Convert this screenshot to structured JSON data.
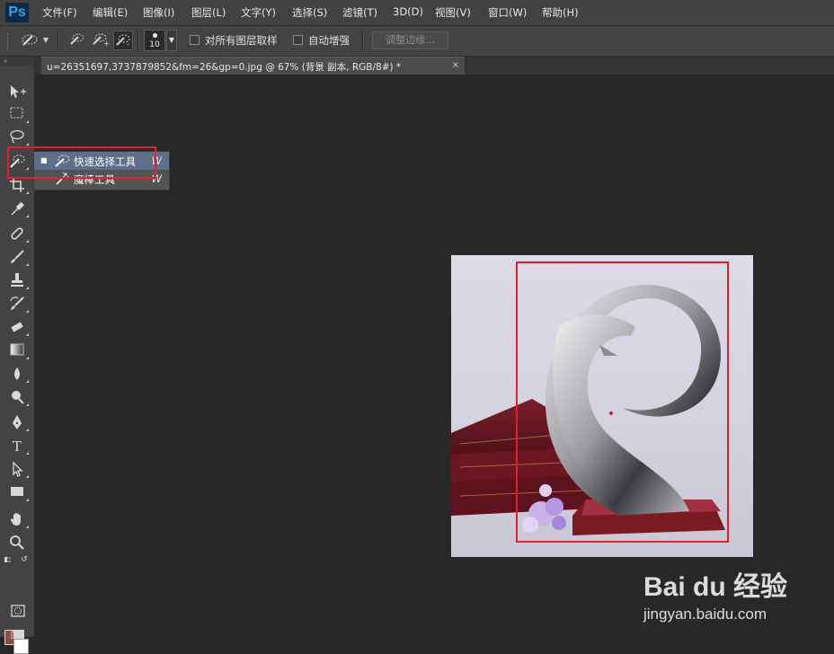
{
  "app": {
    "logo": "Ps",
    "menu": [
      "文件(F)",
      "编辑(E)",
      "图像(I)",
      "图层(L)",
      "文字(Y)",
      "选择(S)",
      "滤镜(T)",
      "3D(D)",
      "视图(V)",
      "窗口(W)",
      "帮助(H)"
    ]
  },
  "options": {
    "brush_size": "10",
    "sample_all_layers_label": "对所有图层取样",
    "auto_enhance_label": "自动增强",
    "refine_edge_label": "调整边缘..."
  },
  "document": {
    "tab_title": "u=26351697,3737879852&fm=26&gp=0.jpg @ 67% (背景 副本, RGB/8#) *",
    "close_glyph": "×"
  },
  "toolbox": {
    "header": "»",
    "foreground_color": "#8b4d3d",
    "background_color": "#ffffff"
  },
  "flyout": {
    "items": [
      {
        "label": "快速选择工具",
        "shortcut": "W",
        "selected": true,
        "icon": "quick-selection-icon"
      },
      {
        "label": "魔棒工具",
        "shortcut": "W",
        "selected": false,
        "icon": "magic-wand-icon"
      }
    ]
  },
  "annotation": {
    "color": "#e0202a"
  },
  "watermark": {
    "brand": "Bai du 经验",
    "url": "jingyan.baidu.com"
  }
}
